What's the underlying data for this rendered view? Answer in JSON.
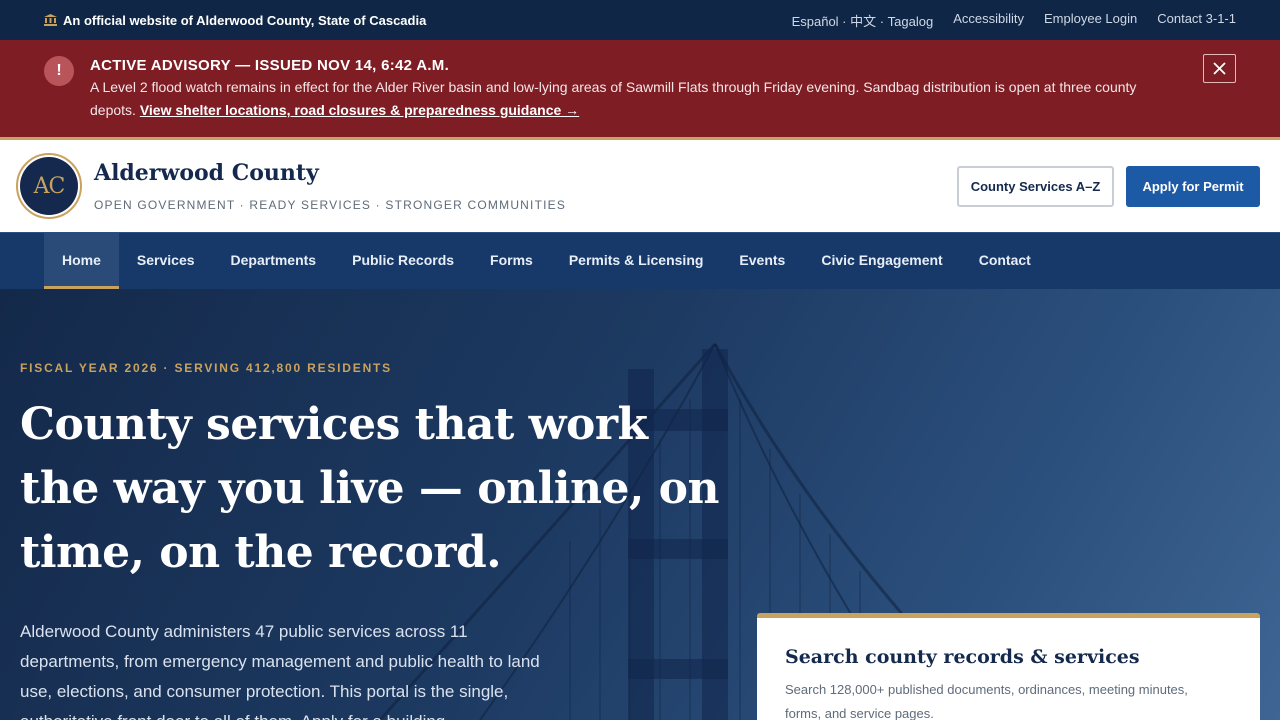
{
  "gov_bar": {
    "official_text": "An official website of Alderwood County, State of Cascadia",
    "links": [
      "Español · 中文 · Tagalog",
      "Accessibility",
      "Employee Login",
      "Contact 3-1-1"
    ]
  },
  "advisory": {
    "icon": "!",
    "title": "ACTIVE ADVISORY — ISSUED NOV 14, 6:42 A.M.",
    "text": "A Level 2 flood watch remains in effect for the Alder River basin and low-lying areas of Sawmill Flats through Friday evening. Sandbag distribution is open at three county depots.",
    "link": "View shelter locations, road closures & preparedness guidance →"
  },
  "header": {
    "seal_text": "AC",
    "name": "Alderwood County",
    "tagline": "OPEN GOVERNMENT · READY SERVICES · STRONGER COMMUNITIES",
    "btn_services": "County Services A–Z",
    "btn_permit": "Apply for Permit"
  },
  "nav": {
    "items": [
      "Home",
      "Services",
      "Departments",
      "Public Records",
      "Forms",
      "Permits & Licensing",
      "Events",
      "Civic Engagement",
      "Contact"
    ],
    "active": "Home"
  },
  "hero": {
    "eyebrow": "FISCAL YEAR 2026 · SERVING 412,800 RESIDENTS",
    "title": "County services that work the way you live — online, on time, on the record.",
    "lede": "Alderwood County administers 47 public services across 11 departments, from emergency management and public health to land use, elections, and consumer protection. This portal is the single, authoritative front door to all of them. Apply for a building"
  },
  "search_card": {
    "title": "Search county records & services",
    "desc": "Search 128,000+ published documents, ordinances, meeting minutes, forms, and service pages."
  },
  "colors": {
    "navy": "#14294d",
    "gold": "#c9a25e",
    "advisory_red": "#7f1d24",
    "primary_blue": "#1d5aa6"
  }
}
